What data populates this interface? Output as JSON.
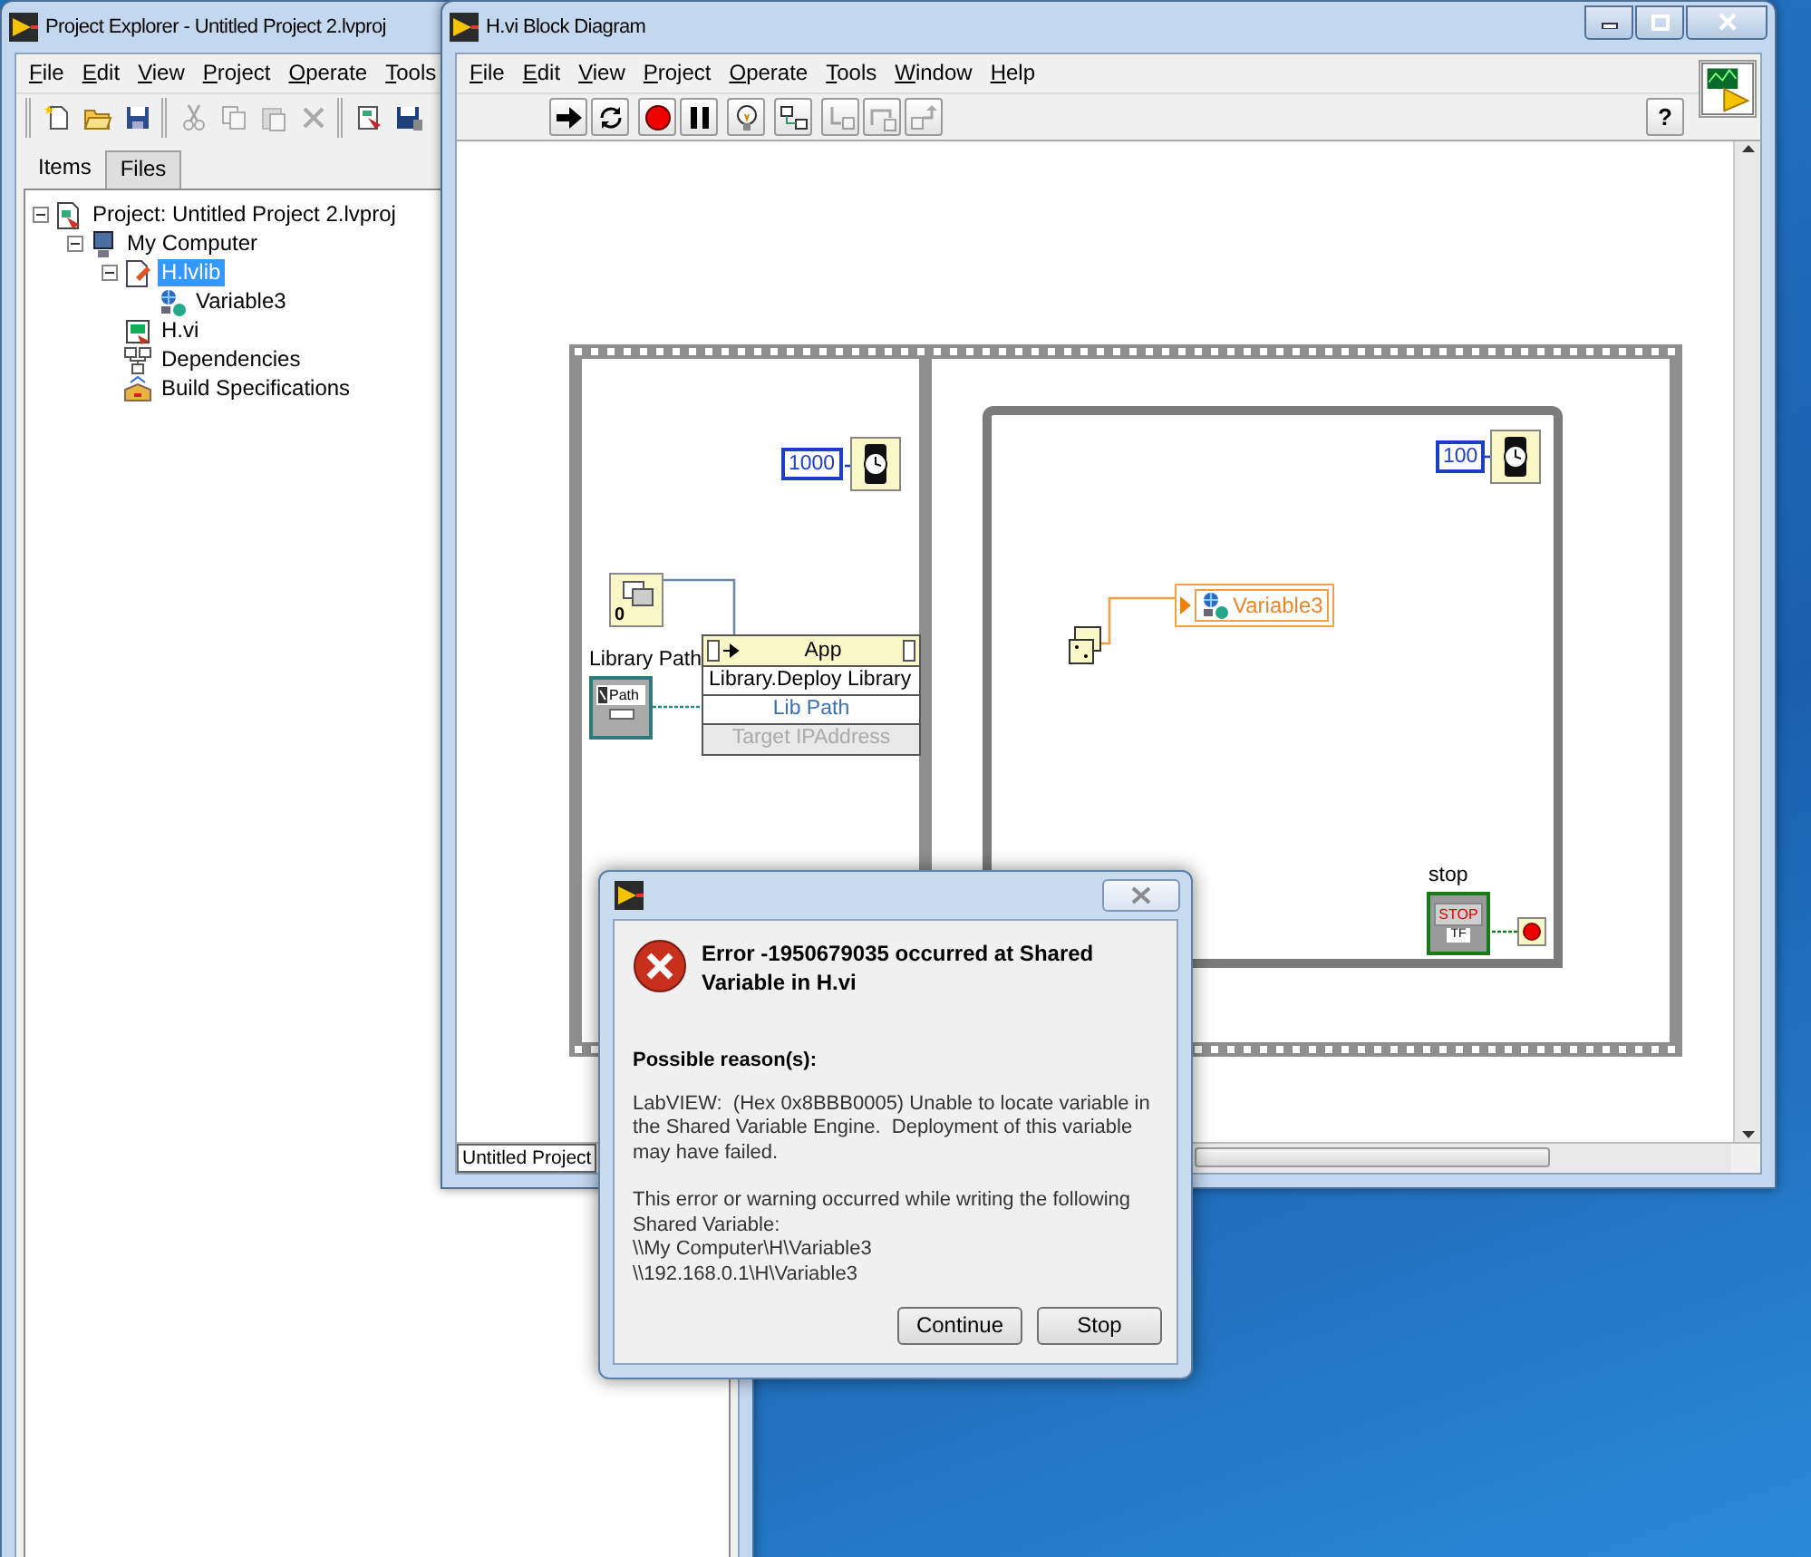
{
  "explorer": {
    "title": "Project Explorer - Untitled Project 2.lvproj",
    "menu": [
      "File",
      "Edit",
      "View",
      "Project",
      "Operate",
      "Tools"
    ],
    "toolbar": [
      [
        {
          "kind": "new",
          "disabled": false
        },
        {
          "kind": "open",
          "disabled": false
        },
        {
          "kind": "save_all",
          "disabled": false
        }
      ],
      [
        {
          "kind": "cut",
          "disabled": true
        },
        {
          "kind": "copy",
          "disabled": true
        },
        {
          "kind": "paste",
          "disabled": true
        },
        {
          "kind": "delete",
          "disabled": true
        }
      ],
      [
        {
          "kind": "build",
          "disabled": false
        },
        {
          "kind": "save",
          "disabled": false
        }
      ]
    ],
    "tabs": [
      {
        "label": "Items",
        "selected": true
      },
      {
        "label": "Files",
        "selected": false
      }
    ],
    "tree": [
      {
        "label": "Project: Untitled Project 2.lvproj",
        "kind": "project",
        "selected": false,
        "expanded": true,
        "children": [
          {
            "label": "My Computer",
            "kind": "computer",
            "selected": false,
            "expanded": true,
            "children": [
              {
                "label": "H.lvlib",
                "kind": "library",
                "selected": true,
                "expanded": true,
                "children": [
                  {
                    "label": "Variable3",
                    "kind": "variable",
                    "selected": false
                  }
                ]
              },
              {
                "label": "H.vi",
                "kind": "vi",
                "selected": false
              },
              {
                "label": "Dependencies",
                "kind": "dependencies",
                "selected": false
              },
              {
                "label": "Build Specifications",
                "kind": "build",
                "selected": false
              }
            ]
          }
        ]
      }
    ]
  },
  "block_diagram": {
    "title": "H.vi Block Diagram",
    "menu": [
      "File",
      "Edit",
      "View",
      "Project",
      "Operate",
      "Tools",
      "Window",
      "Help"
    ],
    "toolbar": [
      [
        {
          "kind": "run",
          "disabled": false
        },
        {
          "kind": "run_continuously",
          "disabled": false
        }
      ],
      [
        {
          "kind": "abort",
          "disabled": false
        },
        {
          "kind": "pause",
          "disabled": false
        }
      ],
      [
        {
          "kind": "highlight",
          "disabled": false
        }
      ],
      [
        {
          "kind": "retain",
          "disabled": false
        }
      ],
      [
        {
          "kind": "step_into",
          "disabled": true
        },
        {
          "kind": "step_over",
          "disabled": true
        },
        {
          "kind": "step_out",
          "disabled": true
        }
      ]
    ],
    "help_button": "?",
    "status_text": "Untitled Project",
    "frame_1": {
      "wait_constant": "1000",
      "app_ref_index": "0",
      "path_control": {
        "label": "Library Path",
        "text": "Path"
      },
      "property_node": {
        "class": "App",
        "method": "Library.Deploy Library",
        "params": [
          {
            "label": "Lib Path",
            "disabled": false
          },
          {
            "label": "Target IPAddress",
            "disabled": true
          }
        ]
      }
    },
    "frame_2": {
      "wait_constant": "100",
      "shared_variable": "Variable3",
      "stop_control": {
        "label": "stop",
        "text": "STOP",
        "type": "TF"
      }
    }
  },
  "dialog": {
    "heading": "Error -1950679035 occurred at Shared Variable in H.vi",
    "section_title": "Possible reason(s):",
    "paragraphs": [
      "LabVIEW:  (Hex 0x8BBB0005) Unable to locate variable in the Shared Variable Engine.  Deployment of this variable may have failed.",
      "This error or warning occurred while writing the following Shared Variable:"
    ],
    "paths": [
      "\\\\My Computer\\H\\Variable3",
      "\\\\192.168.0.1\\H\\Variable3"
    ],
    "buttons": [
      "Continue",
      "Stop"
    ]
  }
}
